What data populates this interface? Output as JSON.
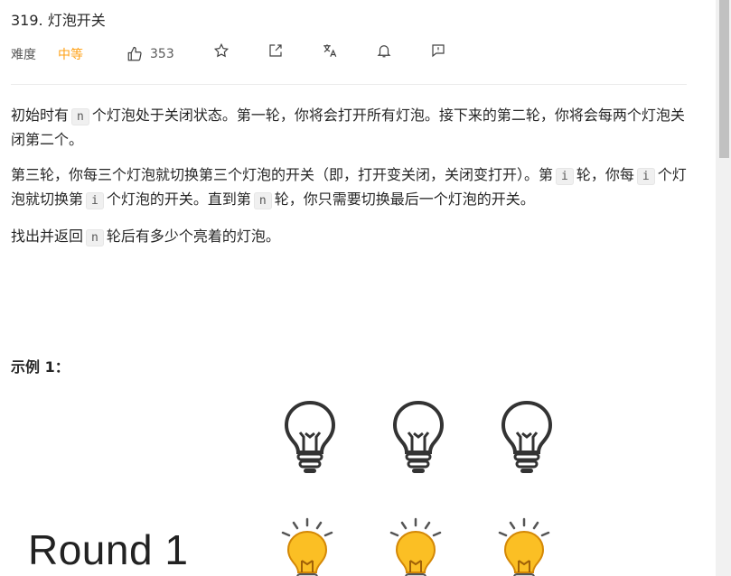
{
  "problem": {
    "title": "319. 灯泡开关",
    "difficulty_label": "难度",
    "difficulty_value": "中等",
    "likes": "353"
  },
  "toolbar": {
    "icons": [
      "thumbs-up-icon",
      "star-icon",
      "share-icon",
      "translate-icon",
      "bell-icon",
      "feedback-icon"
    ]
  },
  "description": {
    "p1_a": "初始时有",
    "p1_code": "n",
    "p1_b": "个灯泡处于关闭状态。第一轮，你将会打开所有灯泡。接下来的第二轮，你将会每两个灯泡关闭第二个。",
    "p2_a": "第三轮，你每三个灯泡就切换第三个灯泡的开关（即，打开变关闭，关闭变打开）。第",
    "p2_code1": "i",
    "p2_b": "轮，你每",
    "p2_code2": "i",
    "p2_c": "个灯泡就切换第",
    "p2_code3": "i",
    "p2_d": "个灯泡的开关。直到第",
    "p2_code4": "n",
    "p2_e": "轮，你只需要切换最后一个灯泡的开关。",
    "p3_a": "找出并返回",
    "p3_code": "n",
    "p3_b": "轮后有多少个亮着的灯泡。"
  },
  "example": {
    "title": "示例 1：",
    "round_label": "Round 1"
  },
  "colors": {
    "accent": "#ffa116",
    "bulb_on": "#fbbf24",
    "bulb_off_stroke": "#333333"
  }
}
